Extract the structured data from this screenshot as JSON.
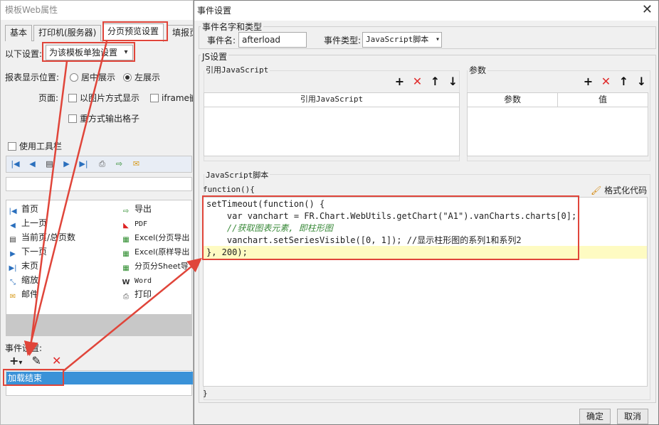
{
  "left_window": {
    "title": "模板Web属性",
    "tabs": [
      "基本",
      "打印机(服务器)",
      "分页预览设置",
      "填报页"
    ],
    "settings_label": "以下设置:",
    "settings_value": "为该模板单独设置",
    "position_label": "报表显示位置:",
    "position_center": "居中展示",
    "position_left": "左展示",
    "page_label": "页面:",
    "page_image_option": "以图片方式显示",
    "page_iframe_option": "iframe嵌",
    "page_reformat_option": "重方式输出格子",
    "use_toolbar": "使用工具栏",
    "button_list": [
      {
        "icon": "first-page-icon",
        "label": "首页"
      },
      {
        "icon": "export-icon",
        "label": "导出"
      },
      {
        "icon": "prev-page-icon",
        "label": "上一页"
      },
      {
        "icon": "pdf-icon",
        "label": "PDF"
      },
      {
        "icon": "page-count-icon",
        "label": "当前页/总页数"
      },
      {
        "icon": "excel-icon",
        "label": "Excel(分页导出"
      },
      {
        "icon": "next-page-icon",
        "label": "下一页"
      },
      {
        "icon": "excel-icon",
        "label": "Excel(原样导出"
      },
      {
        "icon": "last-page-icon",
        "label": "末页"
      },
      {
        "icon": "excel-icon",
        "label": "分页分Sheet导"
      },
      {
        "icon": "zoom-icon",
        "label": "缩放"
      },
      {
        "icon": "word-icon",
        "label": "Word"
      },
      {
        "icon": "email-icon",
        "label": "邮件"
      },
      {
        "icon": "print-icon",
        "label": "打印"
      }
    ],
    "event_settings_label": "事件设置:",
    "event_selected": "加载结束"
  },
  "dialog": {
    "title": "事件设置",
    "group_event": "事件名字和类型",
    "event_name_label": "事件名:",
    "event_name_value": "afterload",
    "event_type_label": "事件类型:",
    "event_type_value": "JavaScript脚本",
    "group_js": "JS设置",
    "ref_js_label": "引用JavaScript",
    "params_label": "参数",
    "ref_js_col": "引用JavaScript",
    "params_col_param": "参数",
    "params_col_value": "值",
    "script_label": "JavaScript脚本",
    "function_open": "function(){",
    "format_code": "格式化代码",
    "code_lines": [
      "setTimeout(function() {",
      "    var vanchart = FR.Chart.WebUtils.getChart(\"A1\").vanCharts.charts[0];",
      "    //获取图表元素, 即柱形图",
      "    vanchart.setSeriesVisible([0, 1]); //显示柱形图的系列1和系列2",
      "}, 200);"
    ],
    "function_close": "}",
    "ok_button": "确定",
    "cancel_button": "取消"
  }
}
